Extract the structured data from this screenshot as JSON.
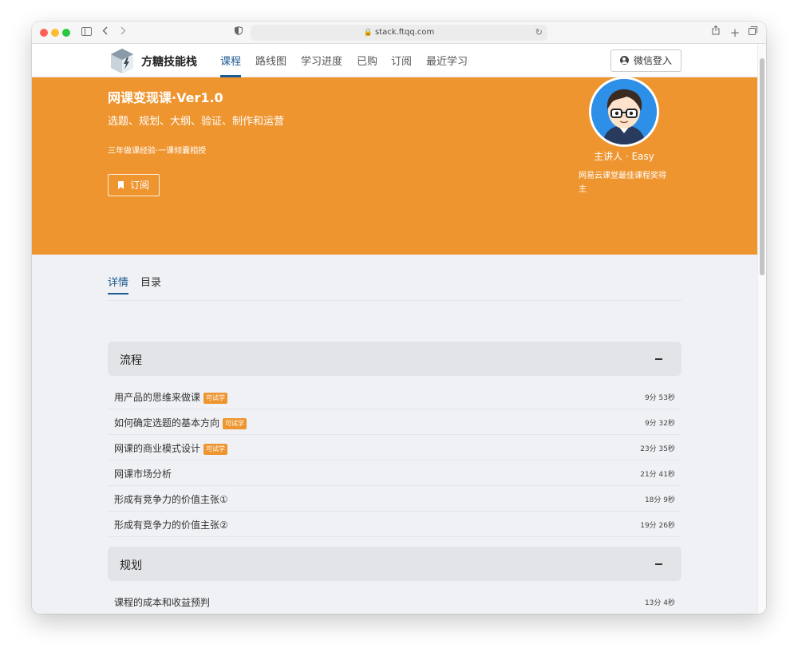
{
  "browser": {
    "url": "stack.ftqq.com"
  },
  "nav": {
    "brand": "方糖技能栈",
    "items": [
      {
        "label": "课程",
        "active": true
      },
      {
        "label": "路线图"
      },
      {
        "label": "学习进度"
      },
      {
        "label": "已购"
      },
      {
        "label": "订阅"
      },
      {
        "label": "最近学习"
      }
    ],
    "login_label": "微信登入"
  },
  "hero": {
    "title": "网课变现课·Ver1.0",
    "subtitle": "选题、规划、大纲、验证、制作和运营",
    "slogan": "三年做课经验·一课倾囊相授",
    "subscribe_label": "订阅",
    "lecturer": "主讲人 · Easy",
    "lecturer_award": "网易云课堂最佳课程奖得主",
    "background_color": "#ee952f"
  },
  "tabs": [
    {
      "label": "详情",
      "active": true
    },
    {
      "label": "目录"
    }
  ],
  "chapters": [
    {
      "title": "流程",
      "lessons": [
        {
          "title": "用产品的思维来做课",
          "trial": "可试学",
          "duration": "9分 53秒"
        },
        {
          "title": "如何确定选题的基本方向",
          "trial": "可试学",
          "duration": "9分 32秒"
        },
        {
          "title": "网课的商业模式设计",
          "trial": "可试学",
          "duration": "23分 35秒"
        },
        {
          "title": "网课市场分析",
          "duration": "21分 41秒"
        },
        {
          "title": "形成有竞争力的价值主张①",
          "duration": "18分 9秒"
        },
        {
          "title": "形成有竞争力的价值主张②",
          "duration": "19分 26秒"
        }
      ]
    },
    {
      "title": "规划",
      "lessons": [
        {
          "title": "课程的成本和收益预判",
          "duration": "13分 4秒"
        }
      ]
    }
  ]
}
